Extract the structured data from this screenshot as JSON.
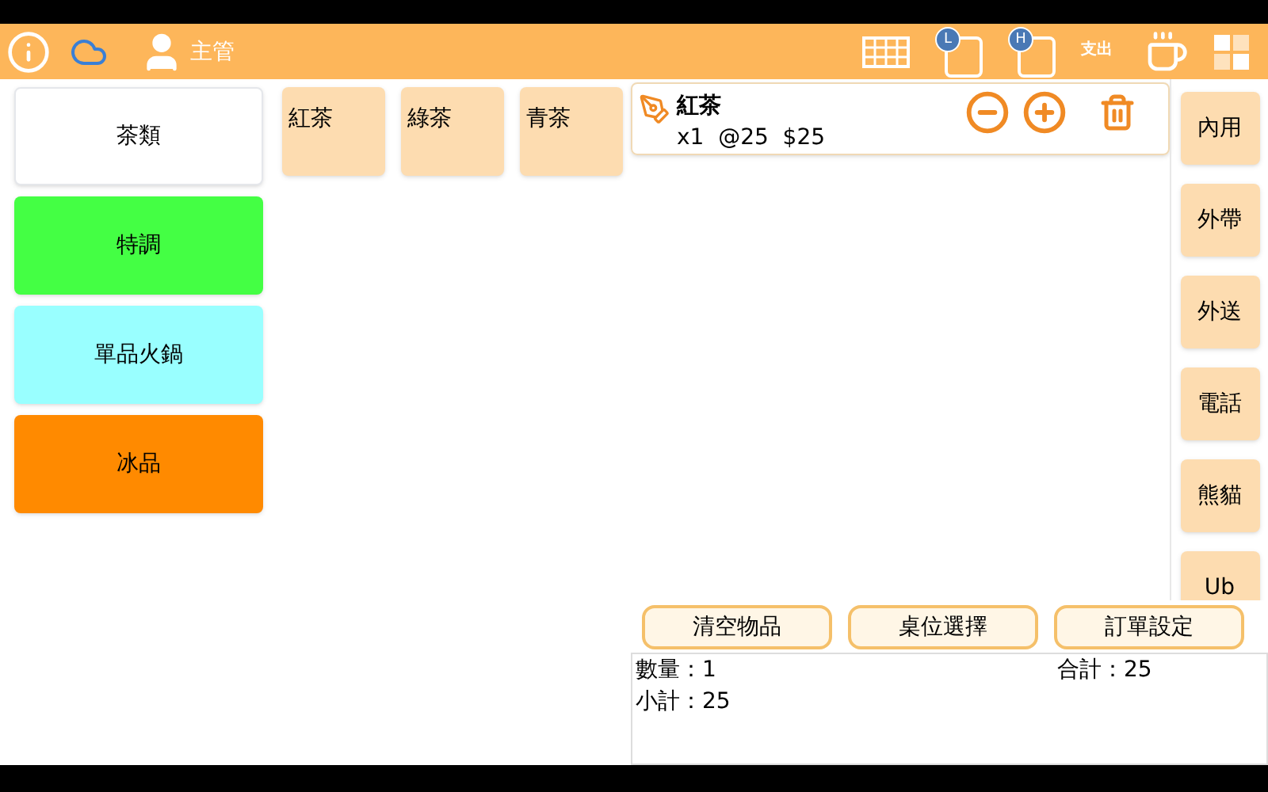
{
  "header": {
    "user": "主管",
    "icons": [
      {
        "kind": "info"
      },
      {
        "kind": "cloud"
      },
      {
        "kind": "table"
      },
      {
        "kind": "badge",
        "badge": "L"
      },
      {
        "kind": "badge",
        "badge": "H"
      },
      {
        "kind": "text",
        "text": "支出"
      },
      {
        "kind": "cup"
      },
      {
        "kind": "grid"
      }
    ]
  },
  "categories": [
    {
      "label": "茶類",
      "selected": true,
      "color": "#ffffff"
    },
    {
      "label": "特調",
      "selected": false,
      "color": "#44ff44"
    },
    {
      "label": "單品火鍋",
      "selected": false,
      "color": "#99ffff"
    },
    {
      "label": "冰品",
      "selected": false,
      "color": "#ff8a00"
    }
  ],
  "products": [
    "紅茶",
    "綠茶",
    "青茶"
  ],
  "order_items": [
    {
      "name": "紅茶",
      "detail": "x1  @25  $25"
    }
  ],
  "order_types": [
    "內用",
    "外帶",
    "外送",
    "電話",
    "熊貓",
    "Ub"
  ],
  "actions": [
    "清空物品",
    "桌位選擇",
    "訂單設定"
  ],
  "summary": {
    "quantity": "數量：1",
    "subtotal": "小計：25",
    "total": "合計：25"
  }
}
